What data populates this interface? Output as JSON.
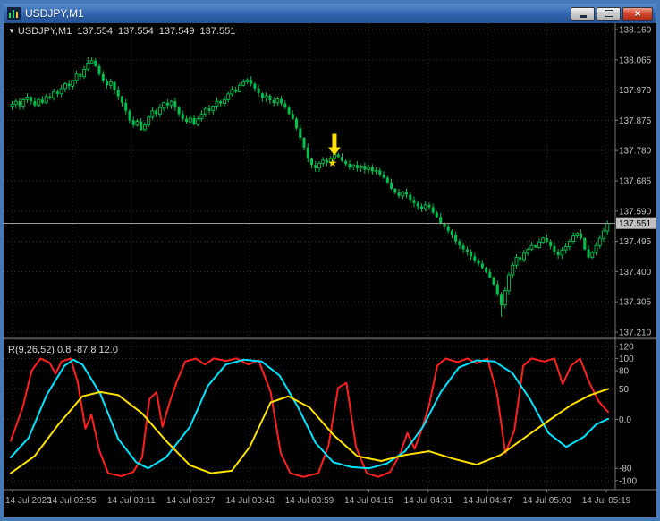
{
  "window": {
    "title": "USDJPY,M1",
    "controls": {
      "minimize": "minimize",
      "maximize": "maximize",
      "close": "×"
    }
  },
  "chart": {
    "readout": {
      "dropdown_icon": "▼",
      "symbol": "USDJPY,M1",
      "open": "137.554",
      "high": "137.554",
      "low": "137.549",
      "close": "137.551"
    },
    "price_axis": {
      "labels": [
        "138.160",
        "138.065",
        "137.970",
        "137.875",
        "137.780",
        "137.685",
        "137.590",
        "137.495",
        "137.400",
        "137.305",
        "137.210"
      ],
      "current_price_label": "137.551"
    },
    "time_axis": {
      "labels": [
        "14 Jul 2023",
        "14 Jul 02:55",
        "14 Jul 03:11",
        "14 Jul 03:27",
        "14 Jul 03:43",
        "14 Jul 03:59",
        "14 Jul 04:15",
        "14 Jul 04:31",
        "14 Jul 04:47",
        "14 Jul 05:03",
        "14 Jul 05:19"
      ]
    }
  },
  "indicator": {
    "name": "R(9,26,52)",
    "values": "0.8 -87.8 12.0",
    "axis_labels": [
      "120",
      "100",
      "80",
      "50",
      "0.0",
      "-80",
      "-100"
    ]
  },
  "chart_data": [
    {
      "type": "candlestick",
      "title": "USDJPY,M1",
      "timeframe": "M1",
      "color": "#00C24E",
      "current_price": 137.551,
      "price_axis_values": [
        138.16,
        138.065,
        137.97,
        137.875,
        137.78,
        137.685,
        137.59,
        137.495,
        137.4,
        137.305,
        137.21
      ],
      "closes": [
        137.925,
        137.935,
        137.92,
        137.94,
        137.948,
        137.935,
        137.922,
        137.94,
        137.93,
        137.95,
        137.945,
        137.965,
        137.958,
        137.975,
        137.99,
        137.982,
        138.0,
        138.02,
        138.012,
        138.035,
        138.055,
        138.062,
        138.045,
        138.02,
        138.0,
        137.985,
        137.995,
        137.97,
        137.95,
        137.93,
        137.905,
        137.875,
        137.86,
        137.872,
        137.845,
        137.86,
        137.885,
        137.905,
        137.895,
        137.915,
        137.93,
        137.922,
        137.935,
        137.915,
        137.895,
        137.88,
        137.87,
        137.882,
        137.862,
        137.88,
        137.895,
        137.912,
        137.905,
        137.92,
        137.935,
        137.928,
        137.94,
        137.958,
        137.972,
        137.965,
        137.985,
        137.995,
        138.002,
        137.99,
        137.975,
        137.96,
        137.945,
        137.952,
        137.938,
        137.93,
        137.942,
        137.928,
        137.915,
        137.895,
        137.88,
        137.85,
        137.82,
        137.79,
        137.755,
        137.735,
        137.725,
        137.74,
        137.75,
        137.742,
        137.755,
        137.768,
        137.76,
        137.748,
        137.738,
        137.728,
        137.735,
        137.725,
        137.732,
        137.72,
        137.728,
        137.715,
        137.718,
        137.705,
        137.695,
        137.68,
        137.66,
        137.648,
        137.638,
        137.65,
        137.642,
        137.625,
        137.615,
        137.605,
        137.598,
        137.61,
        137.602,
        137.585,
        137.572,
        137.552,
        137.54,
        137.528,
        137.515,
        137.495,
        137.482,
        137.47,
        137.462,
        137.448,
        137.435,
        137.425,
        137.412,
        137.398,
        137.382,
        137.36,
        137.33,
        137.295,
        137.34,
        137.39,
        137.42,
        137.445,
        137.438,
        137.458,
        137.47,
        137.482,
        137.476,
        137.492,
        137.505,
        137.495,
        137.48,
        137.462,
        137.452,
        137.468,
        137.478,
        137.495,
        137.512,
        137.52,
        137.505,
        137.47,
        137.445,
        137.46,
        137.482,
        137.505,
        137.528,
        137.551
      ],
      "wick_overrides": {
        "20": {
          "high": 138.073
        },
        "129": {
          "low": 137.258
        }
      },
      "annotations": [
        {
          "type": "arrow-down",
          "bar": 85,
          "price": 137.765,
          "color": "#FFE100"
        },
        {
          "type": "star",
          "bar": 84.5,
          "price": 137.741,
          "color": "#FFD700",
          "symbol": "★"
        }
      ]
    },
    {
      "type": "line",
      "title": "R(9,26,52)",
      "current_values": [
        0.8,
        -87.8,
        12.0
      ],
      "range": [
        -112,
        127
      ],
      "levels": [
        120,
        100,
        80,
        50,
        0,
        -80,
        -100
      ],
      "level_labels": [
        "120",
        "100",
        "80",
        "50",
        "0.0",
        "-80",
        "-100"
      ],
      "series": [
        {
          "name": "wpr-fast",
          "color": "#FF1F1F",
          "width": 2,
          "points": [
            [
              0,
              -35
            ],
            [
              0.02,
              20
            ],
            [
              0.035,
              80
            ],
            [
              0.05,
              100
            ],
            [
              0.065,
              93
            ],
            [
              0.075,
              75
            ],
            [
              0.085,
              95
            ],
            [
              0.1,
              100
            ],
            [
              0.112,
              62
            ],
            [
              0.125,
              -15
            ],
            [
              0.135,
              8
            ],
            [
              0.148,
              -50
            ],
            [
              0.163,
              -88
            ],
            [
              0.185,
              -93
            ],
            [
              0.205,
              -86
            ],
            [
              0.22,
              -62
            ],
            [
              0.232,
              33
            ],
            [
              0.244,
              45
            ],
            [
              0.254,
              -12
            ],
            [
              0.266,
              28
            ],
            [
              0.278,
              62
            ],
            [
              0.292,
              95
            ],
            [
              0.31,
              100
            ],
            [
              0.325,
              90
            ],
            [
              0.34,
              100
            ],
            [
              0.36,
              96
            ],
            [
              0.378,
              100
            ],
            [
              0.398,
              90
            ],
            [
              0.415,
              97
            ],
            [
              0.435,
              45
            ],
            [
              0.452,
              -55
            ],
            [
              0.468,
              -88
            ],
            [
              0.49,
              -94
            ],
            [
              0.515,
              -88
            ],
            [
              0.532,
              -42
            ],
            [
              0.548,
              52
            ],
            [
              0.562,
              60
            ],
            [
              0.578,
              -45
            ],
            [
              0.596,
              -88
            ],
            [
              0.615,
              -94
            ],
            [
              0.635,
              -86
            ],
            [
              0.652,
              -56
            ],
            [
              0.664,
              -22
            ],
            [
              0.676,
              -48
            ],
            [
              0.688,
              -16
            ],
            [
              0.7,
              22
            ],
            [
              0.714,
              88
            ],
            [
              0.728,
              100
            ],
            [
              0.748,
              94
            ],
            [
              0.764,
              100
            ],
            [
              0.78,
              92
            ],
            [
              0.798,
              100
            ],
            [
              0.814,
              42
            ],
            [
              0.828,
              -55
            ],
            [
              0.843,
              -18
            ],
            [
              0.858,
              88
            ],
            [
              0.872,
              100
            ],
            [
              0.893,
              95
            ],
            [
              0.91,
              100
            ],
            [
              0.924,
              58
            ],
            [
              0.938,
              88
            ],
            [
              0.953,
              100
            ],
            [
              0.968,
              62
            ],
            [
              0.984,
              30
            ],
            [
              1,
              12
            ]
          ]
        },
        {
          "name": "wpr-mid",
          "color": "#00E5FF",
          "width": 2,
          "points": [
            [
              0,
              -62
            ],
            [
              0.03,
              -30
            ],
            [
              0.06,
              40
            ],
            [
              0.09,
              88
            ],
            [
              0.105,
              98
            ],
            [
              0.12,
              90
            ],
            [
              0.15,
              42
            ],
            [
              0.18,
              -32
            ],
            [
              0.21,
              -70
            ],
            [
              0.23,
              -80
            ],
            [
              0.26,
              -62
            ],
            [
              0.3,
              -12
            ],
            [
              0.33,
              55
            ],
            [
              0.36,
              90
            ],
            [
              0.39,
              98
            ],
            [
              0.42,
              95
            ],
            [
              0.45,
              72
            ],
            [
              0.48,
              22
            ],
            [
              0.51,
              -38
            ],
            [
              0.54,
              -70
            ],
            [
              0.57,
              -78
            ],
            [
              0.6,
              -80
            ],
            [
              0.63,
              -72
            ],
            [
              0.66,
              -52
            ],
            [
              0.69,
              -12
            ],
            [
              0.72,
              45
            ],
            [
              0.75,
              85
            ],
            [
              0.78,
              97
            ],
            [
              0.81,
              95
            ],
            [
              0.84,
              76
            ],
            [
              0.87,
              32
            ],
            [
              0.9,
              -22
            ],
            [
              0.93,
              -45
            ],
            [
              0.96,
              -28
            ],
            [
              0.98,
              -8
            ],
            [
              1,
              1
            ]
          ]
        },
        {
          "name": "wpr-slow",
          "color": "#FFE100",
          "width": 2,
          "points": [
            [
              0,
              -88
            ],
            [
              0.04,
              -60
            ],
            [
              0.08,
              -8
            ],
            [
              0.12,
              38
            ],
            [
              0.15,
              45
            ],
            [
              0.18,
              40
            ],
            [
              0.22,
              10
            ],
            [
              0.26,
              -35
            ],
            [
              0.3,
              -75
            ],
            [
              0.335,
              -88
            ],
            [
              0.37,
              -84
            ],
            [
              0.4,
              -45
            ],
            [
              0.435,
              28
            ],
            [
              0.465,
              38
            ],
            [
              0.5,
              20
            ],
            [
              0.54,
              -25
            ],
            [
              0.58,
              -60
            ],
            [
              0.62,
              -68
            ],
            [
              0.66,
              -58
            ],
            [
              0.7,
              -52
            ],
            [
              0.74,
              -64
            ],
            [
              0.78,
              -74
            ],
            [
              0.82,
              -58
            ],
            [
              0.86,
              -30
            ],
            [
              0.9,
              -2
            ],
            [
              0.94,
              25
            ],
            [
              0.97,
              40
            ],
            [
              1,
              50
            ]
          ]
        }
      ]
    }
  ]
}
